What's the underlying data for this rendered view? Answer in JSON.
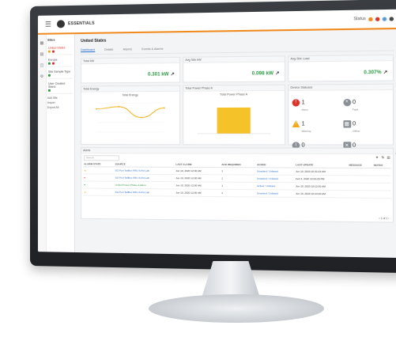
{
  "app": {
    "title": "ESSENTIALS",
    "status_label": "Status"
  },
  "colors": {
    "accent": "#f08a1e",
    "link": "#2a6cc7",
    "good": "#2e9a44",
    "alarm": "#d9342b",
    "warn": "#f2a71b"
  },
  "sidebar": {
    "heading": "Sites",
    "items": [
      {
        "label": "United States"
      },
      {
        "label": "Europe"
      },
      {
        "label": "Site Sample Type"
      },
      {
        "label": "User Created Stand"
      }
    ],
    "links": [
      "Add Site",
      "Import",
      "Export All"
    ]
  },
  "main": {
    "title": "United States",
    "tabs": [
      "Dashboard",
      "Details",
      "Alarms",
      "Events & Alarms"
    ],
    "cards": [
      {
        "label": "Total kW",
        "value": "0.301 kW"
      },
      {
        "label": "Avg Site kW",
        "value": "0.098 kW"
      },
      {
        "label": "Avg Site Load",
        "value": "0.307%"
      }
    ],
    "panels": {
      "total_energy": {
        "title": "Total Energy",
        "subtitle": "Total Energy"
      },
      "total_power": {
        "title": "Total Power Phase A",
        "subtitle": "Total Power Phase A"
      },
      "device_statuses": {
        "title": "Device Statuses",
        "items": [
          {
            "label": "Alarm",
            "count": "1"
          },
          {
            "label": "Fault",
            "count": "0"
          },
          {
            "label": "Warning",
            "count": "1"
          },
          {
            "label": "Offline",
            "count": "0"
          },
          {
            "label": "Information",
            "count": "0"
          },
          {
            "label": "In Maintenance",
            "count": "0"
          }
        ]
      }
    },
    "alerts": {
      "title": "Alerts",
      "search_placeholder": "Search...",
      "columns": [
        "ALARM STATE",
        "SOURCE",
        "LAST ALARM",
        "ACK REQUIRED",
        "ACKED",
        "LAST UPDATE",
        "MESSAGE",
        "NOTES"
      ],
      "rows": [
        {
          "source": "SG Port ToilBox FRU-S-Pol Lab",
          "last_alarm": "Jun 10, 2020 12:00 AM",
          "ack": "1",
          "acked": "Unacked / Unlisted",
          "last_update": "Jun 10, 2020 10:32:23 AM"
        },
        {
          "source": "SG Port ToilBox FRU-S-Pol Lab",
          "last_alarm": "Jun 10, 2020 12:00 AM",
          "ack": "1",
          "acked": "Unacked / Unlisted",
          "last_update": "Feb 6, 2020 10:00:29 PM"
        },
        {
          "source": "United Power Phase A Alarm",
          "last_alarm": "Jun 10, 2020 12:00 AM",
          "ack": "1",
          "acked": "Acked / Unlisted",
          "last_update": "Jun 10, 2020 10:12:00 AM"
        },
        {
          "source": "SG Port ToilBox FRU-S-Pol Lab",
          "last_alarm": "Jun 10, 2020 12:00 AM",
          "ack": "1",
          "acked": "Unacked / Unlisted",
          "last_update": "Jun 10, 2020 10:10:00 AM"
        }
      ],
      "pager": "1 of 1"
    }
  },
  "chart_data": [
    {
      "type": "line",
      "title": "Total Energy",
      "series": [
        {
          "name": "Total Energy",
          "values": [
            3.2,
            3.5,
            2.0,
            3.3
          ]
        }
      ]
    },
    {
      "type": "bar",
      "title": "Total Power Phase A",
      "categories": [
        "United States"
      ],
      "series": [
        {
          "name": "Total Power Phase A",
          "values": [
            4
          ]
        }
      ]
    }
  ]
}
